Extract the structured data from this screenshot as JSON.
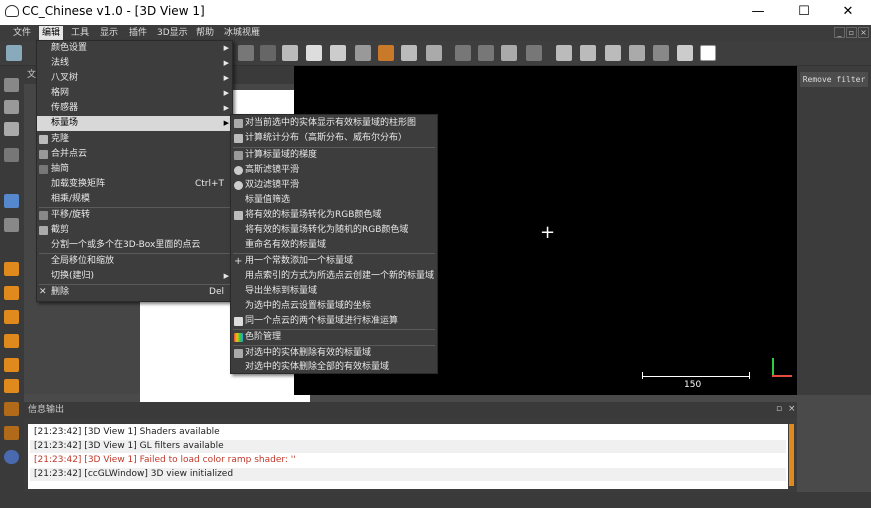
{
  "window": {
    "title": "CC_Chinese v1.0 - [3D View 1]",
    "minimize": "—",
    "maximize": "☐",
    "close": "✕"
  },
  "menubar": {
    "items": [
      "文件",
      "编辑",
      "工具",
      "显示",
      "插件",
      "3D显示",
      "帮助",
      "冰城视雁"
    ],
    "active_index": 1,
    "mdi_buttons": [
      "_",
      "▫",
      "×"
    ]
  },
  "edit_menu": {
    "items": [
      {
        "label": "颜色设置",
        "submenu": true
      },
      {
        "label": "法线",
        "submenu": true
      },
      {
        "label": "八叉树",
        "submenu": true
      },
      {
        "label": "格网",
        "submenu": true
      },
      {
        "label": "传感器",
        "submenu": true
      },
      {
        "label": "标量场",
        "submenu": true,
        "highlighted": true
      },
      {
        "label": "克隆",
        "icon": "clone-icon"
      },
      {
        "label": "合并点云",
        "icon": "merge-icon"
      },
      {
        "label": "抽简",
        "icon": "subsample-icon"
      },
      {
        "label": "加载变换矩阵",
        "shortcut": "Ctrl+T"
      },
      {
        "label": "相乘/规模"
      },
      {
        "label": "平移/旋转",
        "icon": "translate-rotate-icon"
      },
      {
        "label": "截剪",
        "icon": "crop-icon"
      },
      {
        "label": "分割一个或多个在3D-Box里面的点云"
      },
      {
        "label": "全局移位和缩放"
      },
      {
        "label": "切换(建归)",
        "submenu": true
      },
      {
        "label": "删除",
        "shortcut": "Del",
        "icon": "delete-icon"
      }
    ]
  },
  "scalar_submenu": {
    "items": [
      "对当前选中的实体显示有效标量域的柱形图",
      "计算统计分布（高斯分布、威布尔分布）",
      "计算标量域的梯度",
      "高斯滤镜平滑",
      "双边滤镜平滑",
      "标量值筛选",
      "将有效的标量场转化为RGB颜色域",
      "将有效的标量场转化为随机的RGB颜色域",
      "重命名有效的标量域",
      "用一个常数添加一个标量域",
      "用点索引的方式为所选点云创建一个新的标量域",
      "导出坐标到标量域",
      "为选中的点云设置标量域的坐标",
      "同一个点云的两个标量域进行标准运算",
      "色阶管理",
      "对选中的实体删除有效的标量域",
      "对选中的实体删除全部的有效标量域"
    ]
  },
  "db_panel": {
    "title": "文"
  },
  "view3d": {
    "scale_label": "150",
    "cursor": "+"
  },
  "right_panel": {
    "remove_filter_label": "Remove filter"
  },
  "console": {
    "title": "信息输出",
    "lines": [
      {
        "text": "[21:23:42] [3D View 1] Shaders available",
        "color": "#222222"
      },
      {
        "text": "[21:23:42] [3D View 1] GL filters available",
        "color": "#222222"
      },
      {
        "text": "[21:23:42] [3D View 1] Failed to load color ramp shader: ''",
        "color": "#c0392b"
      },
      {
        "text": "[21:23:42] [ccGLWindow] 3D view initialized",
        "color": "#222222"
      }
    ]
  },
  "colors": {
    "accent_orange": "#e08a1e",
    "highlight": "#d8d8d8",
    "error_red": "#c0392b"
  }
}
